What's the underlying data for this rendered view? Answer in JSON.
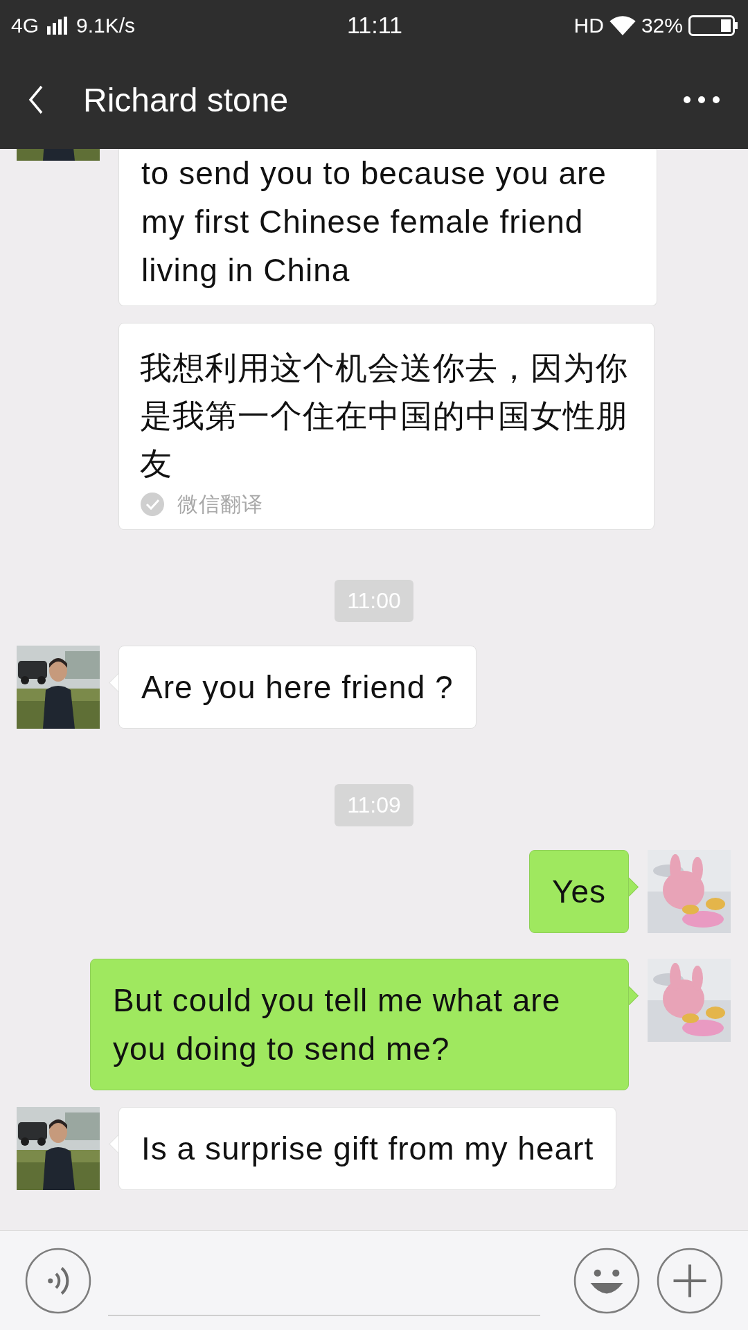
{
  "status_bar": {
    "network": "4G",
    "speed": "9.1K/s",
    "time": "11:11",
    "hd": "HD",
    "battery": "32%"
  },
  "header": {
    "title": "Richard stone"
  },
  "messages": [
    {
      "kind": "incoming",
      "clipped": true,
      "text": "to send you to because you are my first Chinese female friend living in China"
    },
    {
      "kind": "translation",
      "text": "我想利用这个机会送你去，因为你是我第一个住在中国的中国女性朋友",
      "source": "微信翻译"
    },
    {
      "kind": "time",
      "text": "11:00"
    },
    {
      "kind": "incoming",
      "text": "Are you here friend ?"
    },
    {
      "kind": "time",
      "text": "11:09"
    },
    {
      "kind": "outgoing",
      "text": "Yes"
    },
    {
      "kind": "outgoing",
      "text": "But could you tell me what are you doing to send me?"
    },
    {
      "kind": "incoming",
      "text": "Is a surprise gift from my heart"
    }
  ]
}
